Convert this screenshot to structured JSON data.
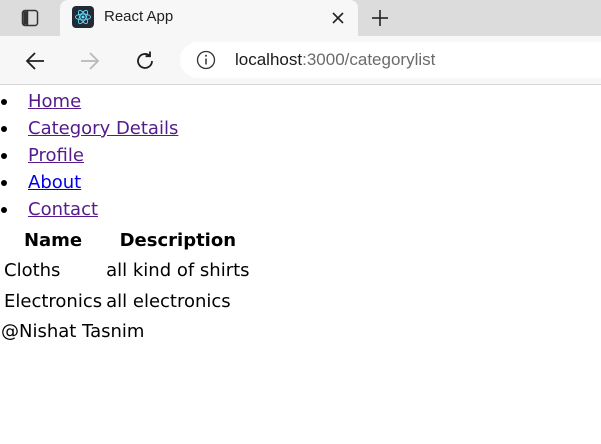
{
  "browser": {
    "tab_title": "React App",
    "url_host": "localhost",
    "url_path": ":3000/categorylist",
    "icons": {
      "sidebar": "sidebar-toggle-icon",
      "favicon": "react-logo-icon",
      "close": "close-icon",
      "new_tab": "plus-icon",
      "back": "back-arrow-icon",
      "forward": "forward-arrow-icon",
      "reload": "reload-icon",
      "info": "info-icon"
    },
    "colors": {
      "tabstrip": "#dcdcdc",
      "toolbar": "#f7f7f7",
      "react": "#61dafb"
    }
  },
  "nav": {
    "items": [
      {
        "label": "Home",
        "state": "visited"
      },
      {
        "label": "Category Details",
        "state": "visited"
      },
      {
        "label": "Profile",
        "state": "visited"
      },
      {
        "label": "About",
        "state": "unvisited"
      },
      {
        "label": "Contact",
        "state": "visited"
      }
    ]
  },
  "table": {
    "headers": [
      "Name",
      "Description"
    ],
    "rows": [
      [
        "Cloths",
        "all kind of shirts"
      ],
      [
        "Electronics",
        "all electronics"
      ]
    ]
  },
  "footer": {
    "text": "@Nishat Tasnim"
  }
}
